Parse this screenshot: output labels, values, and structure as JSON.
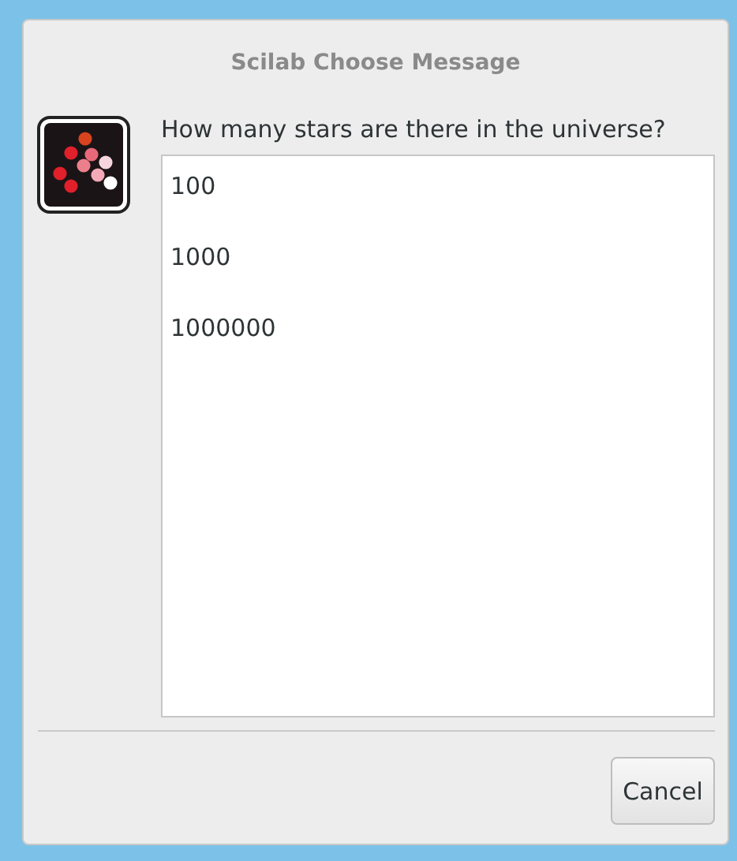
{
  "window": {
    "title": "Scilab Choose Message"
  },
  "message": "How many stars are there in the universe?",
  "options": [
    "100",
    "1000",
    "1000000"
  ],
  "buttons": [
    "Cancel"
  ]
}
